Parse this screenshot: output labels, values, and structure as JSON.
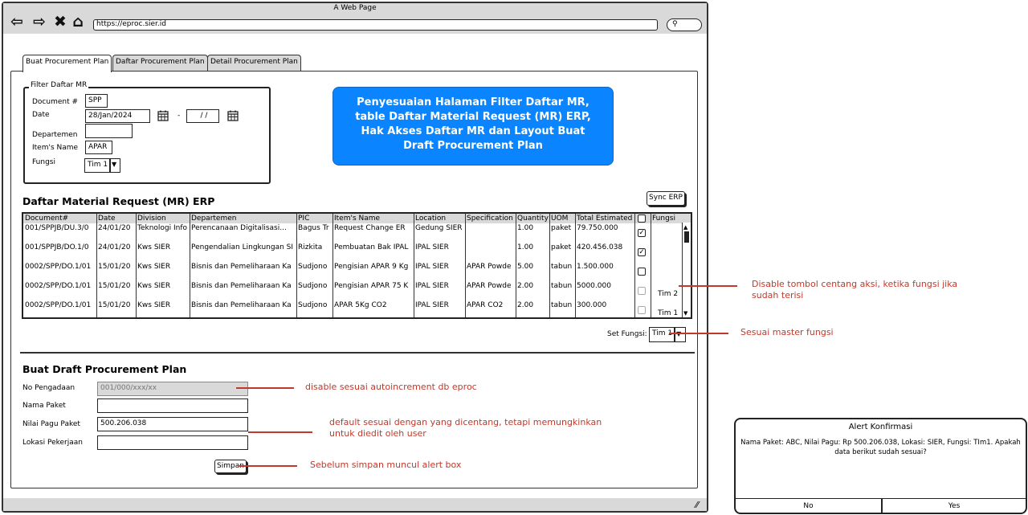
{
  "browser": {
    "window_title": "A Web Page",
    "url": "https://eproc.sier.id",
    "search_icon": "search-icon"
  },
  "tabs": [
    {
      "label": "Buat Procurement Plan",
      "active": true
    },
    {
      "label": "Daftar Procurement Plan",
      "active": false
    },
    {
      "label": "Detail Procurement Plan",
      "active": false
    }
  ],
  "filter": {
    "legend": "Filter Daftar MR",
    "document_label": "Document #",
    "document_value": "SPP",
    "date_label": "Date",
    "date_from": "28/Jan/2024",
    "date_separator": "-",
    "date_to": "/ /",
    "departemen_label": "Departemen",
    "departemen_value": "",
    "item_label": "Item's Name",
    "item_value": "APAR",
    "fungsi_label": "Fungsi",
    "fungsi_value": "Tim 1"
  },
  "callout": "Penyesuaian Halaman Filter Daftar MR, table Daftar Material Request (MR) ERP, Hak Akses Daftar MR dan Layout Buat Draft Procurement Plan",
  "mr_section": {
    "title": "Daftar Material Request (MR) ERP",
    "sync_button": "Sync ERP",
    "columns": [
      "Document#",
      "Date",
      "Division",
      "Departemen",
      "PIC",
      "Item's Name",
      "Location",
      "Specification",
      "Quantity",
      "UOM",
      "Total Estimated",
      "",
      "Fungsi"
    ],
    "rows": [
      {
        "doc": "001/SPPJB/DU.3/0",
        "date": "24/01/20",
        "division": "Teknologi Info",
        "departemen": "Perencanaan Digitalisasi...",
        "pic": "Bagus Tr",
        "item": "Request Change ER",
        "location": "Gedung SIER",
        "spec": "",
        "qty": "1.00",
        "uom": "paket",
        "total": "79.750.000",
        "checked": true,
        "disabled": false,
        "fungsi": ""
      },
      {
        "doc": "001/SPPJB/DO.1/0",
        "date": "24/01/20",
        "division": "Kws SIER",
        "departemen": "Pengendalian Lingkungan SI",
        "pic": "Rizkita",
        "item": "Pembuatan Bak IPAL",
        "location": "IPAL SIER",
        "spec": "",
        "qty": "1.00",
        "uom": "paket",
        "total": "420.456.038",
        "checked": true,
        "disabled": false,
        "fungsi": ""
      },
      {
        "doc": "0002/SPP/DO.1/01",
        "date": "15/01/20",
        "division": "Kws SIER",
        "departemen": "Bisnis dan Pemeliharaan Ka",
        "pic": "Sudjono",
        "item": "Pengisian APAR 9 Kg",
        "location": "IPAL SIER",
        "spec": "APAR Powde",
        "qty": "5.00",
        "uom": "tabun",
        "total": "1.500.000",
        "checked": false,
        "disabled": false,
        "fungsi": ""
      },
      {
        "doc": "0002/SPP/DO.1/01",
        "date": "15/01/20",
        "division": "Kws SIER",
        "departemen": "Bisnis dan Pemeliharaan Ka",
        "pic": "Sudjono",
        "item": "Pengisian APAR 75 K",
        "location": "IPAL SIER",
        "spec": "APAR Powde",
        "qty": "2.00",
        "uom": "tabun",
        "total": "5000.000",
        "checked": false,
        "disabled": true,
        "fungsi": "Tim 2"
      },
      {
        "doc": "0002/SPP/DO.1/01",
        "date": "15/01/20",
        "division": "Kws SIER",
        "departemen": "Bisnis dan Pemeliharaan Ka",
        "pic": "Sudjono",
        "item": "APAR 5Kg CO2",
        "location": "IPAL SIER",
        "spec": "APAR CO2",
        "qty": "2.00",
        "uom": "tabun",
        "total": "300.000",
        "checked": false,
        "disabled": true,
        "fungsi": "Tim 1"
      }
    ],
    "set_fungsi_label": "Set Fungsi:",
    "set_fungsi_value": "Tim 1"
  },
  "draft": {
    "title": "Buat Draft Procurement Plan",
    "no_pengadaan_label": "No Pengadaan",
    "no_pengadaan_placeholder": "001/000/xxx/xx",
    "nama_paket_label": "Nama Paket",
    "nama_paket_value": "",
    "nilai_pagu_label": "Nilai Pagu Paket",
    "nilai_pagu_value": "500.206.038",
    "lokasi_label": "Lokasi Pekerjaan",
    "lokasi_value": "",
    "save_button": "Simpan"
  },
  "annotations": {
    "disable_checkbox": "Disable tombol centang aksi, ketika fungsi jika sudah terisi",
    "master_fungsi": "Sesuai master fungsi",
    "autoincrement": "disable sesuai autoincrement db eproc",
    "default_value": "default sesuai dengan yang dicentang, tetapi memungkinkan untuk diedit oleh user",
    "alert_before_save": "Sebelum simpan muncul alert box"
  },
  "alert": {
    "title": "Alert Konfirmasi",
    "message": "Nama Paket: ABC, Nilai Pagu: Rp 500.206.038, Lokasi: SIER, Fungsi: TIm1. Apakah data berikut sudah sesuai?",
    "no_button": "No",
    "yes_button": "Yes"
  },
  "colors": {
    "callout_bg": "#0a84ff",
    "annotation": "#c0392b",
    "header_gray": "#d9d9d9"
  }
}
